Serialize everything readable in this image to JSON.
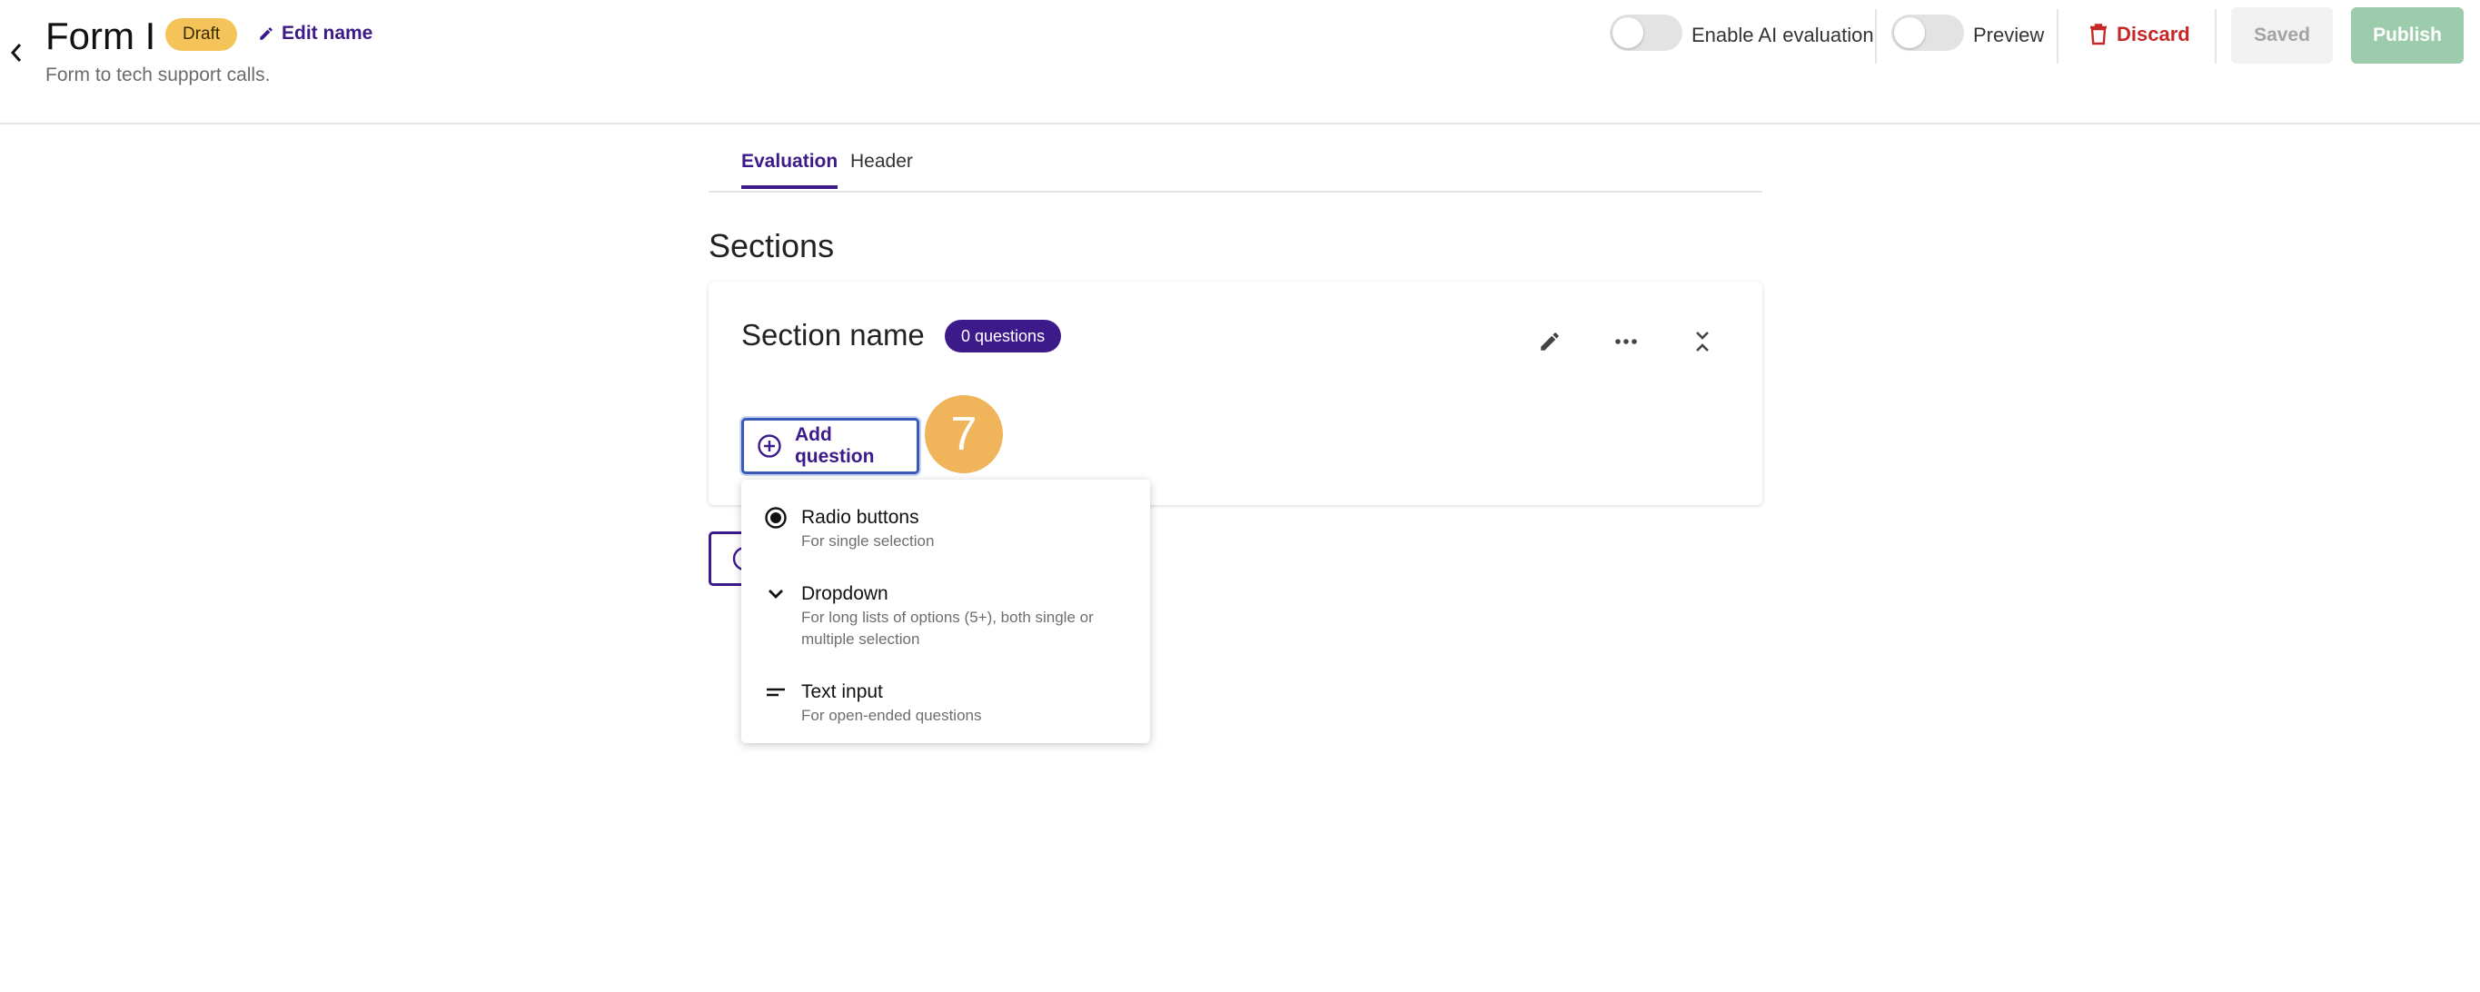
{
  "header": {
    "title": "Form I",
    "status_badge": "Draft",
    "edit_name_label": "Edit name",
    "subtitle": "Form to tech support calls.",
    "ai_toggle_label": "Enable AI evaluation",
    "ai_toggle_on": false,
    "preview_toggle_label": "Preview",
    "preview_toggle_on": false,
    "discard_label": "Discard",
    "saved_label": "Saved",
    "publish_label": "Publish"
  },
  "tabs": [
    {
      "label": "Evaluation",
      "active": true
    },
    {
      "label": "Header",
      "active": false
    }
  ],
  "sections_title": "Sections",
  "section": {
    "name": "Section name",
    "question_count_badge": "0 questions",
    "add_question_label": "Add question"
  },
  "step_marker": "7",
  "question_type_menu": [
    {
      "icon": "radio-icon",
      "label": "Radio buttons",
      "description": "For single selection"
    },
    {
      "icon": "chevron-down-icon",
      "label": "Dropdown",
      "description": "For long lists of options (5+), both single or multiple selection"
    },
    {
      "icon": "short-text-icon",
      "label": "Text input",
      "description": "For open-ended questions"
    }
  ],
  "colors": {
    "brand_purple": "#3c1a8a",
    "draft_badge": "#f4c45a",
    "discard_red": "#c62828",
    "publish_green": "#9dccac",
    "step_marker": "#f0b45a"
  }
}
